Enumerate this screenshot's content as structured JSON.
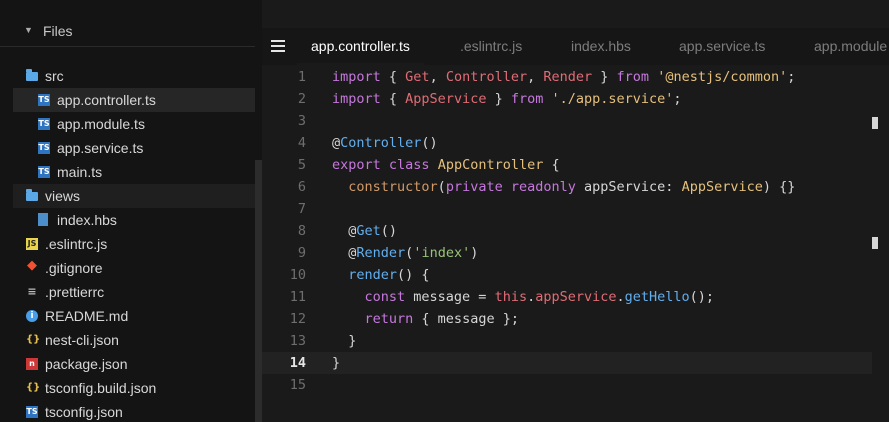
{
  "sidebar": {
    "header": "Files",
    "items": [
      {
        "label": "src",
        "icon": "folder-icon",
        "depth": 1
      },
      {
        "label": "app.controller.ts",
        "icon": "ts-file-icon",
        "depth": 2,
        "selected": true
      },
      {
        "label": "app.module.ts",
        "icon": "ts-file-icon",
        "depth": 2
      },
      {
        "label": "app.service.ts",
        "icon": "ts-file-icon",
        "depth": 2
      },
      {
        "label": "main.ts",
        "icon": "ts-file-icon",
        "depth": 2
      },
      {
        "label": "views",
        "icon": "folder-icon",
        "depth": 1
      },
      {
        "label": "index.hbs",
        "icon": "hbs-file-icon",
        "depth": 2
      },
      {
        "label": ".eslintrc.js",
        "icon": "js-file-icon",
        "depth": 1
      },
      {
        "label": ".gitignore",
        "icon": "git-icon",
        "depth": 1
      },
      {
        "label": ".prettierrc",
        "icon": "prettier-icon",
        "depth": 1
      },
      {
        "label": "README.md",
        "icon": "info-icon",
        "depth": 1
      },
      {
        "label": "nest-cli.json",
        "icon": "json-icon",
        "depth": 1
      },
      {
        "label": "package.json",
        "icon": "npm-icon",
        "depth": 1
      },
      {
        "label": "tsconfig.build.json",
        "icon": "json-icon",
        "depth": 1
      },
      {
        "label": "tsconfig.json",
        "icon": "ts-file-icon",
        "depth": 1
      }
    ]
  },
  "tabs": [
    {
      "label": "app.controller.ts",
      "active": true
    },
    {
      "label": ".eslintrc.js",
      "active": false
    },
    {
      "label": "index.hbs",
      "active": false
    },
    {
      "label": "app.service.ts",
      "active": false
    },
    {
      "label": "app.module",
      "active": false
    }
  ],
  "editor": {
    "current_line": 14,
    "lines": [
      {
        "n": "1",
        "tokens": [
          [
            "t-keyword",
            "import"
          ],
          [
            "t-punct",
            " { "
          ],
          [
            "t-ident",
            "Get"
          ],
          [
            "t-punct",
            ", "
          ],
          [
            "t-ident",
            "Controller"
          ],
          [
            "t-punct",
            ", "
          ],
          [
            "t-ident",
            "Render"
          ],
          [
            "t-punct",
            " } "
          ],
          [
            "t-keyword",
            "from"
          ],
          [
            "t-punct",
            " "
          ],
          [
            "t-string",
            "'@nestjs/common'"
          ],
          [
            "t-punct",
            ";"
          ]
        ]
      },
      {
        "n": "2",
        "tokens": [
          [
            "t-keyword",
            "import"
          ],
          [
            "t-punct",
            " { "
          ],
          [
            "t-ident",
            "AppService"
          ],
          [
            "t-punct",
            " } "
          ],
          [
            "t-keyword",
            "from"
          ],
          [
            "t-punct",
            " "
          ],
          [
            "t-string",
            "'./app.service'"
          ],
          [
            "t-punct",
            ";"
          ]
        ]
      },
      {
        "n": "3",
        "tokens": []
      },
      {
        "n": "4",
        "tokens": [
          [
            "t-punct",
            "@"
          ],
          [
            "t-func",
            "Controller"
          ],
          [
            "t-punct",
            "()"
          ]
        ]
      },
      {
        "n": "5",
        "tokens": [
          [
            "t-keyword",
            "export"
          ],
          [
            "t-punct",
            " "
          ],
          [
            "t-keyword",
            "class"
          ],
          [
            "t-punct",
            " "
          ],
          [
            "t-class",
            "AppController"
          ],
          [
            "t-punct",
            " {"
          ]
        ]
      },
      {
        "n": "6",
        "tokens": [
          [
            "t-punct",
            "  "
          ],
          [
            "t-param",
            "constructor"
          ],
          [
            "t-punct",
            "("
          ],
          [
            "t-keyword",
            "private"
          ],
          [
            "t-punct",
            " "
          ],
          [
            "t-keyword",
            "readonly"
          ],
          [
            "t-punct",
            " appService: "
          ],
          [
            "t-class",
            "AppService"
          ],
          [
            "t-punct",
            ") {}"
          ]
        ]
      },
      {
        "n": "7",
        "tokens": []
      },
      {
        "n": "8",
        "tokens": [
          [
            "t-punct",
            "  @"
          ],
          [
            "t-func",
            "Get"
          ],
          [
            "t-punct",
            "()"
          ]
        ]
      },
      {
        "n": "9",
        "tokens": [
          [
            "t-punct",
            "  @"
          ],
          [
            "t-func",
            "Render"
          ],
          [
            "t-punct",
            "("
          ],
          [
            "t-string-green",
            "'index'"
          ],
          [
            "t-punct",
            ")"
          ]
        ]
      },
      {
        "n": "10",
        "tokens": [
          [
            "t-punct",
            "  "
          ],
          [
            "t-func",
            "render"
          ],
          [
            "t-punct",
            "() {"
          ]
        ]
      },
      {
        "n": "11",
        "tokens": [
          [
            "t-punct",
            "    "
          ],
          [
            "t-keyword",
            "const"
          ],
          [
            "t-punct",
            " message = "
          ],
          [
            "t-ident",
            "this"
          ],
          [
            "t-punct",
            "."
          ],
          [
            "t-ident",
            "appService"
          ],
          [
            "t-punct",
            "."
          ],
          [
            "t-func",
            "getHello"
          ],
          [
            "t-punct",
            "();"
          ]
        ]
      },
      {
        "n": "12",
        "tokens": [
          [
            "t-punct",
            "    "
          ],
          [
            "t-keyword",
            "return"
          ],
          [
            "t-punct",
            " { message };"
          ]
        ]
      },
      {
        "n": "13",
        "tokens": [
          [
            "t-punct",
            "  }"
          ]
        ]
      },
      {
        "n": "14",
        "tokens": [
          [
            "t-punct",
            "}"
          ]
        ]
      },
      {
        "n": "15",
        "tokens": []
      }
    ]
  },
  "colors": {
    "background": "#1a1a1a",
    "sidebar_bg": "#141414",
    "keyword": "#c678dd",
    "identifier": "#e06c75",
    "string": "#e5c07b",
    "function": "#61afef"
  }
}
